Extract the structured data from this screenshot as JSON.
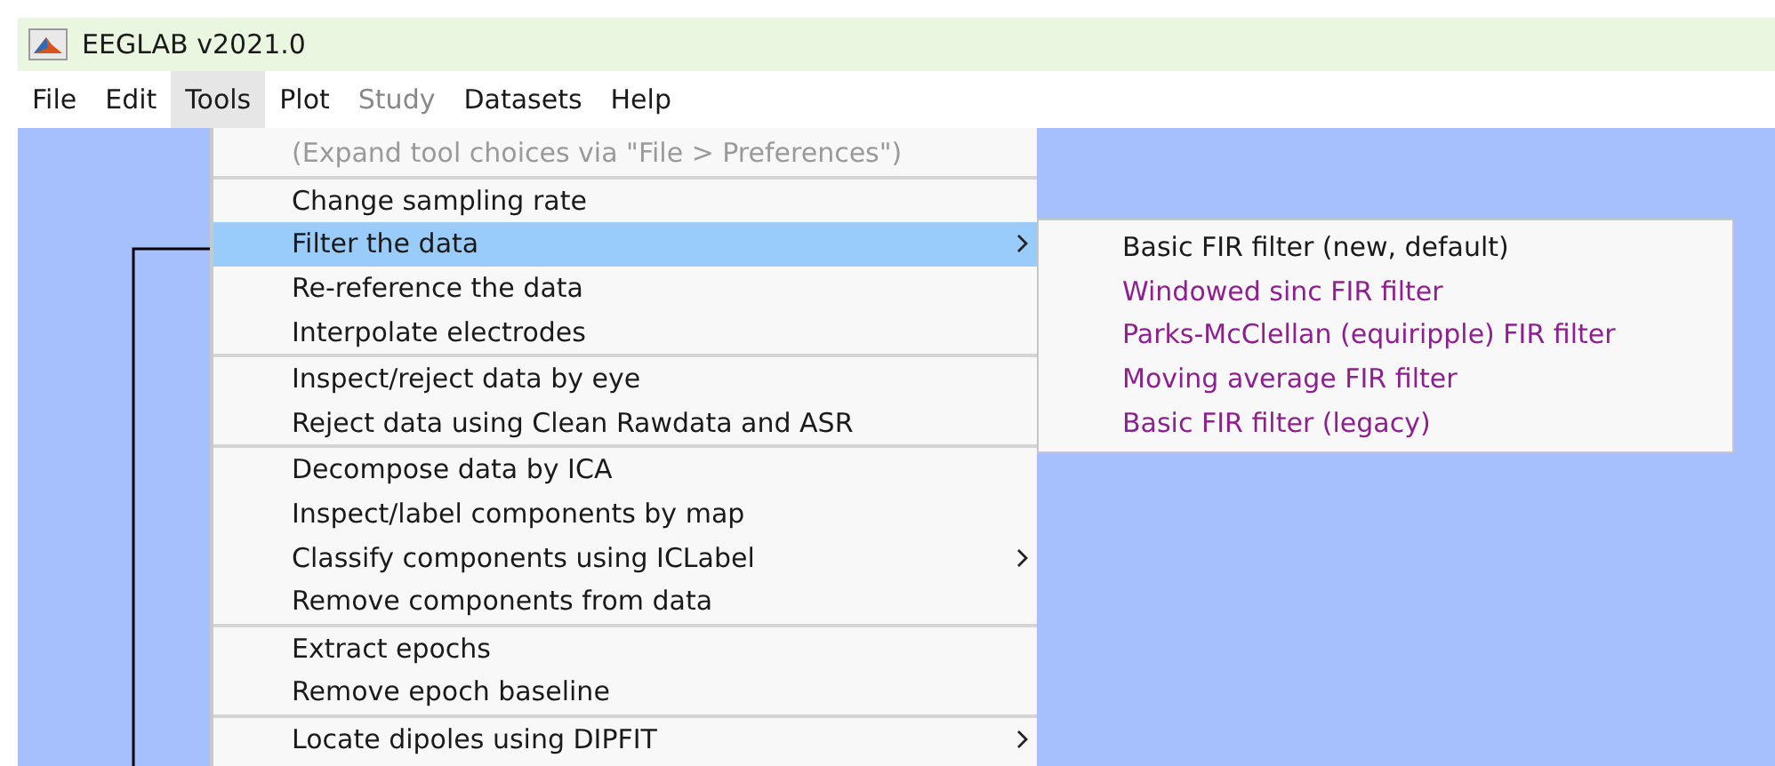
{
  "window": {
    "title": "EEGLAB v2021.0"
  },
  "menu_bar": [
    {
      "label": "File",
      "disabled": false,
      "selected": false
    },
    {
      "label": "Edit",
      "disabled": false,
      "selected": false
    },
    {
      "label": "Tools",
      "disabled": false,
      "selected": true
    },
    {
      "label": "Plot",
      "disabled": false,
      "selected": false
    },
    {
      "label": "Study",
      "disabled": true,
      "selected": false
    },
    {
      "label": "Datasets",
      "disabled": false,
      "selected": false
    },
    {
      "label": "Help",
      "disabled": false,
      "selected": false
    }
  ],
  "tools_menu": {
    "sections": [
      {
        "items": [
          {
            "label": "(Expand tool choices via \"File > Preferences\")",
            "disabled": true,
            "selected": false,
            "has_submenu": false
          }
        ]
      },
      {
        "items": [
          {
            "label": "Change sampling rate",
            "disabled": false,
            "selected": false,
            "has_submenu": false
          },
          {
            "label": "Filter the data",
            "disabled": false,
            "selected": true,
            "has_submenu": true
          },
          {
            "label": "Re-reference the data",
            "disabled": false,
            "selected": false,
            "has_submenu": false
          },
          {
            "label": "Interpolate electrodes",
            "disabled": false,
            "selected": false,
            "has_submenu": false
          }
        ]
      },
      {
        "items": [
          {
            "label": "Inspect/reject data by eye",
            "disabled": false,
            "selected": false,
            "has_submenu": false
          },
          {
            "label": "Reject data using Clean Rawdata and ASR",
            "disabled": false,
            "selected": false,
            "has_submenu": false
          }
        ]
      },
      {
        "items": [
          {
            "label": "Decompose data by ICA",
            "disabled": false,
            "selected": false,
            "has_submenu": false
          },
          {
            "label": "Inspect/label components by map",
            "disabled": false,
            "selected": false,
            "has_submenu": false
          },
          {
            "label": "Classify components using ICLabel",
            "disabled": false,
            "selected": false,
            "has_submenu": true
          },
          {
            "label": "Remove components from data",
            "disabled": false,
            "selected": false,
            "has_submenu": false
          }
        ]
      },
      {
        "items": [
          {
            "label": "Extract epochs",
            "disabled": false,
            "selected": false,
            "has_submenu": false
          },
          {
            "label": "Remove epoch baseline",
            "disabled": false,
            "selected": false,
            "has_submenu": false
          }
        ]
      },
      {
        "items": [
          {
            "label": "Locate dipoles using DIPFIT",
            "disabled": false,
            "selected": false,
            "has_submenu": true
          }
        ]
      }
    ]
  },
  "filter_submenu": {
    "items": [
      {
        "label": "Basic FIR filter (new, default)",
        "color": "#1a1a1a"
      },
      {
        "label": "Windowed sinc FIR filter",
        "color": "#8e1f8e"
      },
      {
        "label": "Parks-McClellan (equiripple) FIR filter",
        "color": "#8e1f8e"
      },
      {
        "label": "Moving average FIR filter",
        "color": "#8e1f8e"
      },
      {
        "label": "Basic FIR filter (legacy)",
        "color": "#8e1f8e"
      }
    ]
  }
}
